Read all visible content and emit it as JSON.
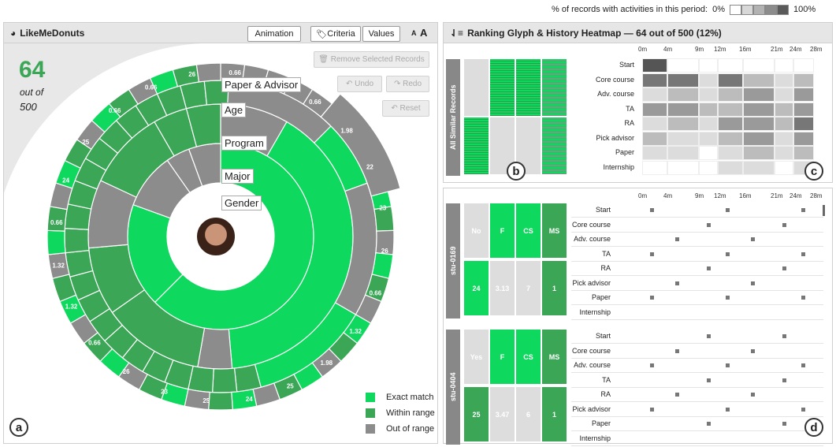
{
  "legend_top": {
    "label": "% of records with activities in this period:",
    "min": "0%",
    "max": "100%",
    "shades": [
      "#ffffff",
      "#d8d8d8",
      "#b2b2b2",
      "#8c8c8c",
      "#5a5a5a"
    ]
  },
  "left": {
    "title": "LikeMeDonuts",
    "buttons": {
      "animation": "Animation",
      "criteria": "Criteria",
      "values": "Values",
      "small_a": "A",
      "big_a": "A",
      "remove": "Remove Selected Records",
      "undo": "Undo",
      "redo": "Redo",
      "reset": "Reset"
    },
    "count": "64",
    "out_of": "out of",
    "total": "500",
    "ring_labels": [
      "Paper & Advisor",
      "Age",
      "Program",
      "Major",
      "Gender"
    ],
    "legend": [
      "Exact match",
      "Within range",
      "Out of range"
    ],
    "panel_letter": "a"
  },
  "colors": {
    "exact": "#0fd85e",
    "within": "#3aa656",
    "out": "#8c8c8c"
  },
  "heatmap": {
    "title": "Ranking Glyph & History Heatmap — 64 out of 500 (12%)",
    "group_label": "All Similar Records",
    "letter": "c",
    "letter_b": "b",
    "ticks": [
      "0m",
      "4m",
      "9m",
      "12m",
      "16m",
      "21m",
      "24m",
      "28m"
    ],
    "rows": [
      "Start",
      "Core course",
      "Adv. course",
      "TA",
      "RA",
      "Pick advisor",
      "Paper",
      "Internship"
    ]
  },
  "students": {
    "letter": "d",
    "ticks": [
      "0m",
      "4m",
      "9m",
      "12m",
      "16m",
      "21m",
      "24m",
      "28m"
    ],
    "rows": [
      "Start",
      "Core course",
      "Adv. course",
      "TA",
      "RA",
      "Pick advisor",
      "Paper",
      "Internship"
    ],
    "records": [
      {
        "id": "stu-0169",
        "top": [
          "No",
          "F",
          "CS",
          "MS"
        ],
        "bottom": [
          "24",
          "3.13",
          "7",
          "1"
        ]
      },
      {
        "id": "stu-0404",
        "top": [
          "Yes",
          "F",
          "CS",
          "MS"
        ],
        "bottom": [
          "25",
          "3.47",
          "6",
          "1"
        ]
      }
    ]
  }
}
